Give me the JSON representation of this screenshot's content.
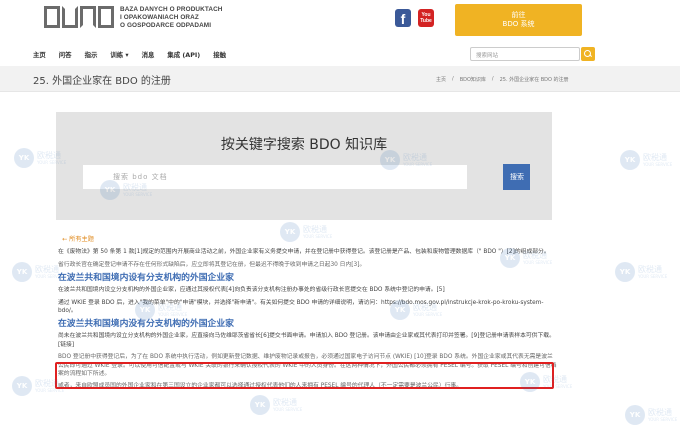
{
  "header": {
    "logo_text": [
      "BAZA DANYCH O PRODUKTACH",
      "I OPAKOWANIACH ORAZ",
      "O GOSPODARCE ODPADAMI"
    ],
    "facebook_label": "f",
    "youtube_label": "You Tube",
    "go_button_line1": "前往",
    "go_button_line2": "BDO 系统"
  },
  "nav": {
    "items": [
      "主页",
      "问答",
      "指示",
      "训练 ▾",
      "消息",
      "集成 (API)",
      "接触"
    ],
    "search_placeholder": "搜索网站"
  },
  "page": {
    "title": "25. 外国企业家在 BDO 的注册",
    "breadcrumb": [
      "主页",
      "BDO知识库",
      "25. 外国企业家在 BDO 的注册"
    ]
  },
  "kb": {
    "title": "按关键字搜索 BDO 知识库",
    "placeholder": "搜索 bdo 文档",
    "button": "搜索"
  },
  "content": {
    "topic_link": "← 所有主题",
    "para1": "在《废物法》第 50 条第 1 款[1]规定的范围内开展商业活动之前，外国企业家有义务提交申请，并在登记册中获得登记。该登记册是产品、包装和废物管理数据库（\" BDO \"）[2]的组成部分。",
    "para2": "省行政长官在确定登记申请不存在任何形式缺陷后，应立即将其登记在册，但最迟不得晚于收到申请之日起30 日内[3]。",
    "h2_1": "在波兰共和国境内设有分支机构的外国企业家",
    "para3": "在波兰共和国境内设立分支机构的外国企业家，应通过其授权代表[4]向负责该分支机构注册办事处的省级行政长官提交在 BDO 系统中登记的申请。[5]",
    "para4": "通过 WKIE 登录 BDO 后，进入\"我的菜单\"中的\"申请\"模块，并选择\"新申请\"。有关如何提交 BDO 申请的详细说明，请访问：https://bdo.mos.gov.pl/instrukcje-krok-po-kroku-system-bdo/。",
    "h2_2": "在波兰共和国境内没有分支机构的外国企业家",
    "para5": "尚未在波兰共和国境内设立分支机构的外国企业家，应直接向马佐维耶茨省省长[6]提交书面申请。申请加入 BDO 登记册。该申请由企业家或其代表打印并签署。[9]登记册申请表样本可供下载。[链接]",
    "para6": "BDO 登记册中获得登记后，为了在 BDO 系统中执行活动，例如更新登记数据、维护废物记录或报告，必须通过国家电子访问节点 (WKIE) [10]登录 BDO 系统。外国企业家或其代表无需是波兰公民即可通过 WKIE 登录。可以使用可信配置或与 WKIE 关联的银行来确认授权代表的 WKIE 中的人员身份。在这两种情况下，外国公民都必须拥有 PESEL 编号。获取 PESEL 编号和创建可信档案的流程如下所述。",
    "para7": "或者，来自欧盟成员国的外国企业家和在第三国设立的企业家都可以选择通过授权代表他们的人来拥有 PESEL 编号的代理人（不一定需要是波兰公民）行事。"
  },
  "watermark": {
    "mark": "YK",
    "name": "欧税通",
    "sub": "YOUR SERVICE"
  }
}
